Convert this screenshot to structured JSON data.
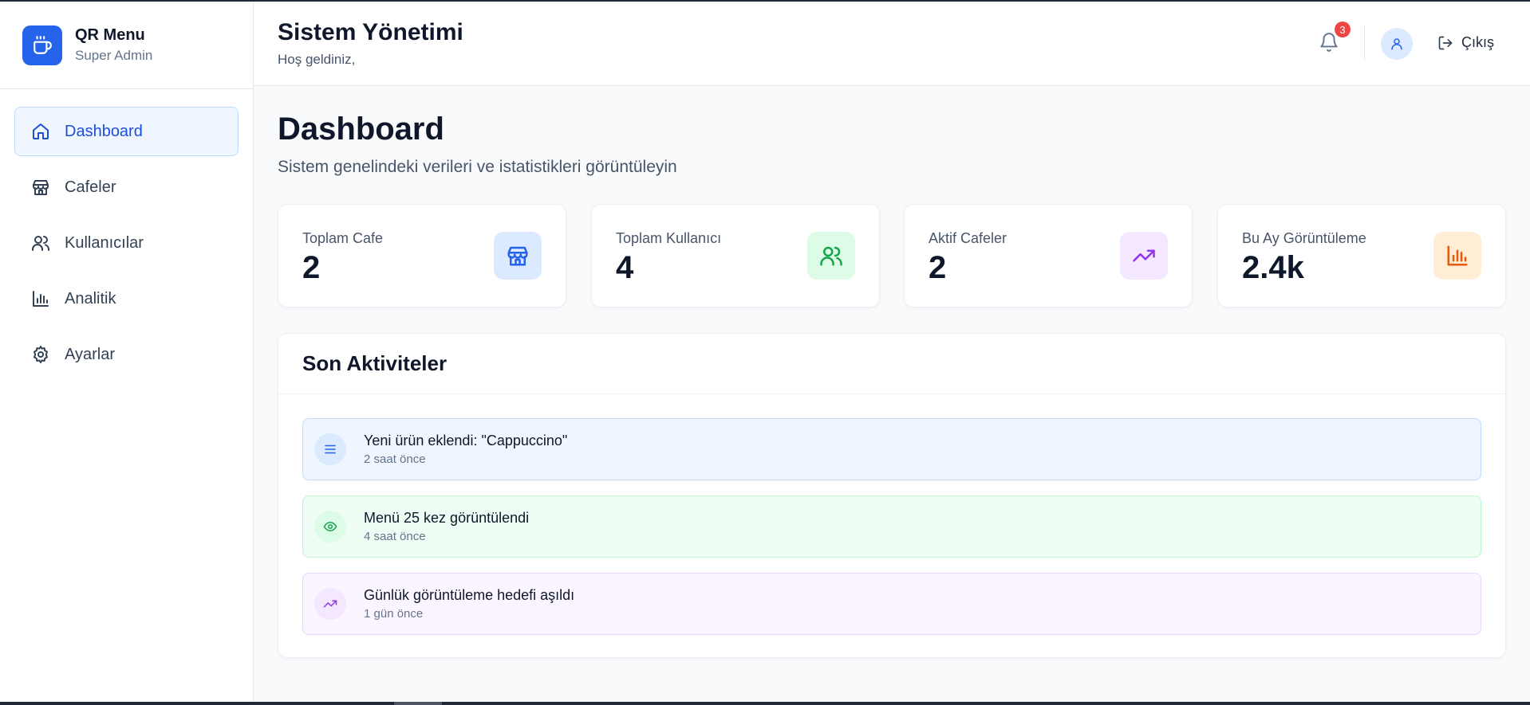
{
  "brand": {
    "title": "QR Menu",
    "subtitle": "Super Admin"
  },
  "sidebar": {
    "items": [
      {
        "label": "Dashboard",
        "icon": "home-icon",
        "active": true
      },
      {
        "label": "Cafeler",
        "icon": "store-icon"
      },
      {
        "label": "Kullanıcılar",
        "icon": "users-icon"
      },
      {
        "label": "Analitik",
        "icon": "bar-chart-icon"
      },
      {
        "label": "Ayarlar",
        "icon": "gear-icon"
      }
    ]
  },
  "header": {
    "title": "Sistem Yönetimi",
    "subtitle": "Hoş geldiniz,",
    "notification_count": "3",
    "logout_label": "Çıkış"
  },
  "main": {
    "title": "Dashboard",
    "subtitle": "Sistem genelindeki verileri ve istatistikleri görüntüleyin",
    "stats": [
      {
        "label": "Toplam Cafe",
        "value": "2",
        "icon": "store-icon",
        "bg": "#dbeafe",
        "color": "#2563eb"
      },
      {
        "label": "Toplam Kullanıcı",
        "value": "4",
        "icon": "users-icon",
        "bg": "#dcfce7",
        "color": "#16a34a"
      },
      {
        "label": "Aktif Cafeler",
        "value": "2",
        "icon": "trending-up-icon",
        "bg": "#f3e8ff",
        "color": "#9333ea"
      },
      {
        "label": "Bu Ay Görüntüleme",
        "value": "2.4k",
        "icon": "bar-chart-icon",
        "bg": "#ffedd5",
        "color": "#ea580c"
      }
    ],
    "activity": {
      "title": "Son Aktiviteler",
      "items": [
        {
          "title": "Yeni ürün eklendi: \"Cappuccino\"",
          "time": "2 saat önce",
          "icon": "menu-icon",
          "bg": "#eff6ff",
          "border": "#bfdbfe",
          "icon_bg": "#dbeafe",
          "color": "#2563eb"
        },
        {
          "title": "Menü 25 kez görüntülendi",
          "time": "4 saat önce",
          "icon": "eye-icon",
          "bg": "#f0fdf4",
          "border": "#bbf7d0",
          "icon_bg": "#dcfce7",
          "color": "#16a34a"
        },
        {
          "title": "Günlük görüntüleme hedefi aşıldı",
          "time": "1 gün önce",
          "icon": "trending-up-icon",
          "bg": "#faf5ff",
          "border": "#e9d5ff",
          "icon_bg": "#f3e8ff",
          "color": "#9333ea"
        }
      ]
    }
  }
}
